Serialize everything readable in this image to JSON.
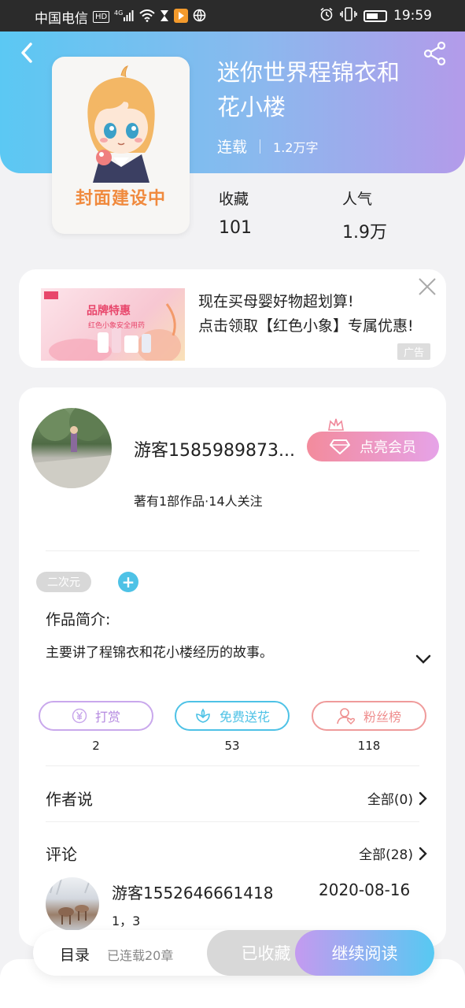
{
  "status_bar": {
    "carrier": "中国电信",
    "hd": "HD",
    "network": "4G",
    "time": "19:59",
    "colors": {
      "bg": "#2b2b2b"
    }
  },
  "header": {
    "back_icon": "chevron-left-icon",
    "share_icon": "share-icon",
    "gradient": [
      "#5bc8f3",
      "#b39bea"
    ]
  },
  "book": {
    "cover_text": "封面建设中",
    "title": "迷你世界程锦衣和花小楼",
    "status": "连载",
    "word_count": "1.2万字",
    "stats": [
      {
        "label": "收藏",
        "value": "101"
      },
      {
        "label": "人气",
        "value": "1.9万"
      }
    ]
  },
  "ad": {
    "image_title": "品牌特惠",
    "image_sub": "红色小象安全用药",
    "headline": "现在买母婴好物超划算!",
    "body": "点击领取【红色小象】专属优惠!",
    "badge": "广告"
  },
  "author": {
    "name": "游客1585989873...",
    "vip_label": "点亮会员",
    "stats": "著有1部作品·14人关注"
  },
  "tags": {
    "items": [
      "二次元"
    ],
    "add": "+"
  },
  "intro": {
    "title": "作品简介:",
    "text": "主要讲了程锦衣和花小楼经历的故事。"
  },
  "actions": [
    {
      "label": "打赏",
      "count": "2",
      "icon": "yen-coin-icon",
      "color": "#b58ae0"
    },
    {
      "label": "免费送花",
      "count": "53",
      "icon": "flower-icon",
      "color": "#4ec2e6"
    },
    {
      "label": "粉丝榜",
      "count": "118",
      "icon": "fans-icon",
      "color": "#ef8f8f"
    }
  ],
  "author_says": {
    "label": "作者说",
    "more": "全部(0)"
  },
  "comments": {
    "label": "评论",
    "more": "全部(28)",
    "items": [
      {
        "user": "游客1552646661418",
        "date": "2020-08-16",
        "text": "1，3"
      }
    ]
  },
  "bottom_bar": {
    "toc": "目录",
    "chapters": "已连载20章",
    "favorite": "已收藏",
    "continue": "继续阅读"
  }
}
